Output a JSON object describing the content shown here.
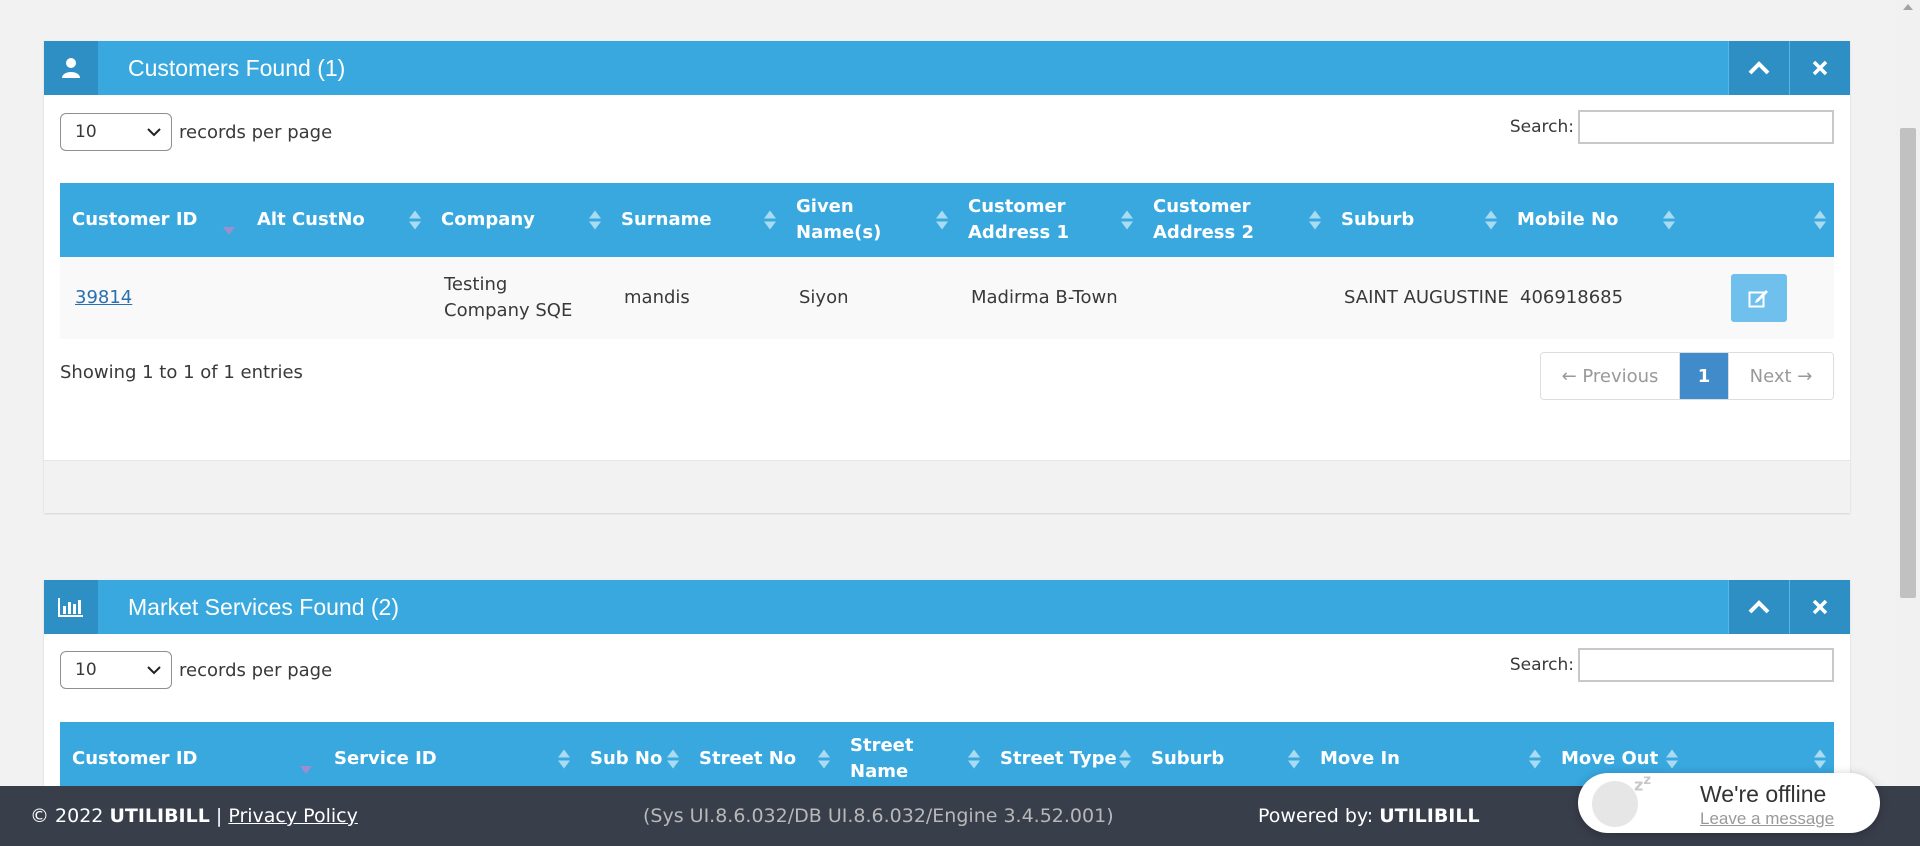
{
  "colors": {
    "header_blue": "#38a8df",
    "header_dark": "#2e8fc5",
    "footer_bg": "#393e4b",
    "link": "#2a6fb0",
    "page_active": "#428bca"
  },
  "icons": {
    "customers": "user-icon",
    "market": "bar-chart-icon",
    "collapse": "chevron-up-icon",
    "close": "close-icon",
    "edit": "edit-icon"
  },
  "customers_widget": {
    "title": "Customers Found (1)",
    "page_size": "10",
    "records_label": "records per page",
    "search_label": "Search:",
    "search_value": "",
    "columns": [
      "Customer ID",
      "Alt CustNo",
      "Company",
      "Surname",
      "Given Name(s)",
      "Customer Address 1",
      "Customer Address 2",
      "Suburb",
      "Mobile No",
      ""
    ],
    "rows": [
      {
        "customer_id": "39814",
        "alt_custno": "",
        "company": "Testing Company SQE",
        "surname": "mandis",
        "given_names": "Siyon",
        "address1": "Madirma B-Town",
        "address2": "",
        "suburb": "SAINT AUGUSTINE",
        "mobile": "406918685"
      }
    ],
    "info": "Showing 1 to 1 of 1 entries",
    "pagination": {
      "previous": "← Previous",
      "current": "1",
      "next": "Next →"
    }
  },
  "market_widget": {
    "title": "Market Services Found (2)",
    "page_size": "10",
    "records_label": "records per page",
    "search_label": "Search:",
    "search_value": "",
    "columns": [
      "Customer ID",
      "Service ID",
      "Sub No",
      "Street No",
      "Street Name",
      "Street Type",
      "Suburb",
      "Move In",
      "Move Out",
      ""
    ]
  },
  "footer": {
    "copyright": "© 2022 ",
    "brand": "UTILIBILL",
    "separator": " | ",
    "privacy": "Privacy Policy",
    "version": "(Sys UI.8.6.032/DB UI.8.6.032/Engine 3.4.52.001)",
    "powered_label": "Powered by: ",
    "powered_brand": "UTILIBILL"
  },
  "chat": {
    "status": "We're offline",
    "action": "Leave a message"
  }
}
